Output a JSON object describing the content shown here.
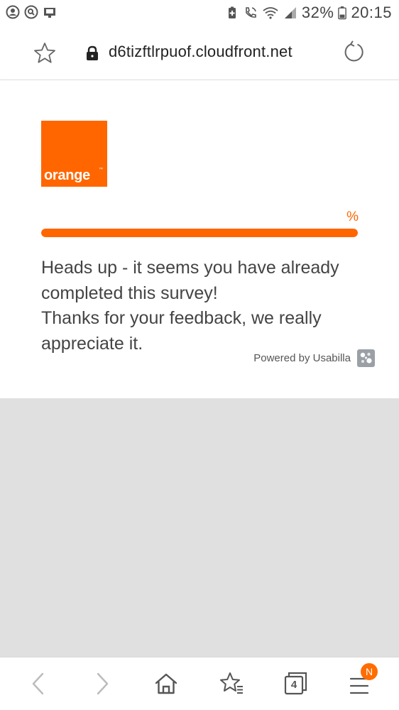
{
  "status_bar": {
    "battery_percent": "32%",
    "time": "20:15",
    "left_icons": [
      "account-circle-icon",
      "search-circle-icon",
      "screenshot-icon"
    ],
    "right_icons": [
      "battery-saver-icon",
      "wifi-calling-icon",
      "wifi-icon",
      "signal-icon",
      "battery-icon"
    ]
  },
  "browser": {
    "url": "d6tizftlrpuof.cloudfront.net",
    "tab_count": "4",
    "notification_badge": "N"
  },
  "survey": {
    "brand_logo_text": "orange",
    "brand_logo_tm": "™",
    "progress_label": "%",
    "progress_fraction": 1.0,
    "message_line1": "Heads up - it seems you have already completed this survey!",
    "message_line2": "Thanks for your feedback, we really appreciate it.",
    "powered_by": "Powered by Usabilla"
  },
  "colors": {
    "brand": "#ff6600",
    "page_background": "#e0e0e0",
    "badge": "#ff6d00"
  }
}
